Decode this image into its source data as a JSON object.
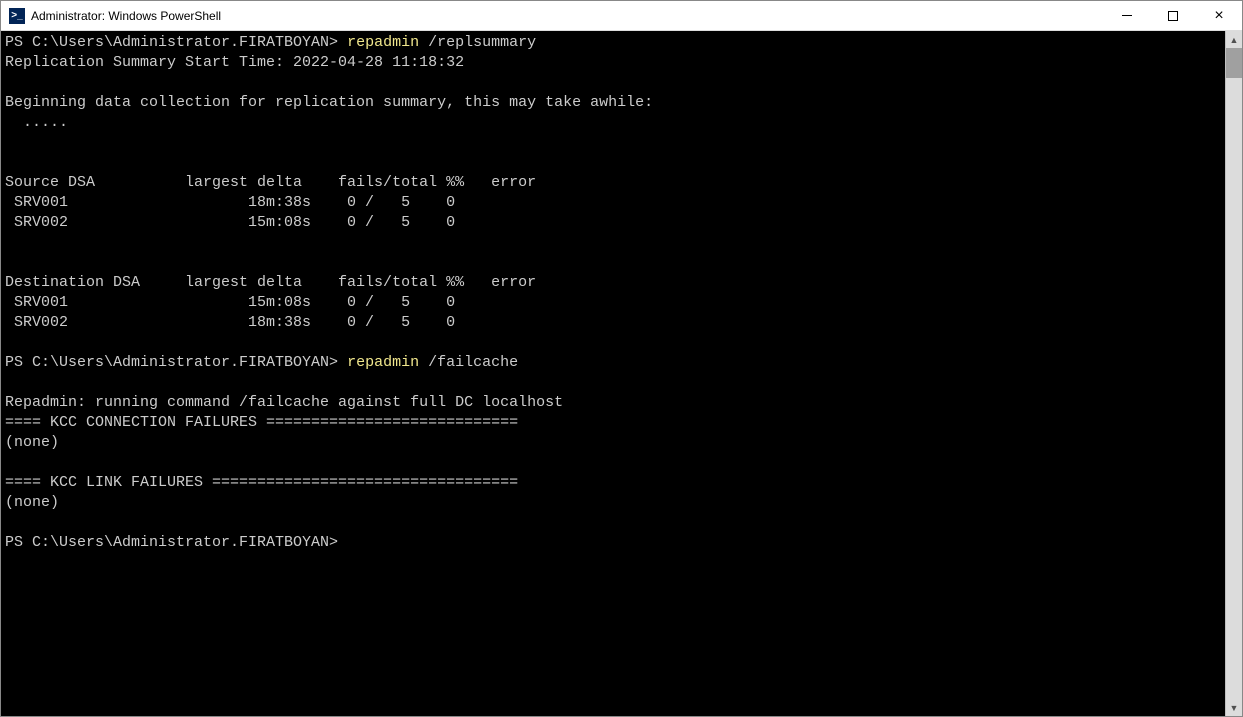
{
  "window": {
    "title": "Administrator: Windows PowerShell",
    "icon_text": ">_"
  },
  "terminal": {
    "prompt": "PS C:\\Users\\Administrator.FIRATBOYAN>",
    "lines": {
      "cmd1_name": "repadmin",
      "cmd1_arg": " /replsummary",
      "start_time": "Replication Summary Start Time: 2022-04-28 11:18:32",
      "collecting": "Beginning data collection for replication summary, this may take awhile:",
      "dots": "  .....",
      "src_header": "Source DSA          largest delta    fails/total %%   error",
      "src_row1": " SRV001                    18m:38s    0 /   5    0",
      "src_row2": " SRV002                    15m:08s    0 /   5    0",
      "dst_header": "Destination DSA     largest delta    fails/total %%   error",
      "dst_row1": " SRV001                    15m:08s    0 /   5    0",
      "dst_row2": " SRV002                    18m:38s    0 /   5    0",
      "cmd2_name": "repadmin",
      "cmd2_arg": " /failcache",
      "fail_running": "Repadmin: running command /failcache against full DC localhost",
      "kcc_conn_hdr": "==== KCC CONNECTION FAILURES ============================",
      "none1": "(none)",
      "kcc_link_hdr": "==== KCC LINK FAILURES ==================================",
      "none2": "(none)"
    }
  }
}
